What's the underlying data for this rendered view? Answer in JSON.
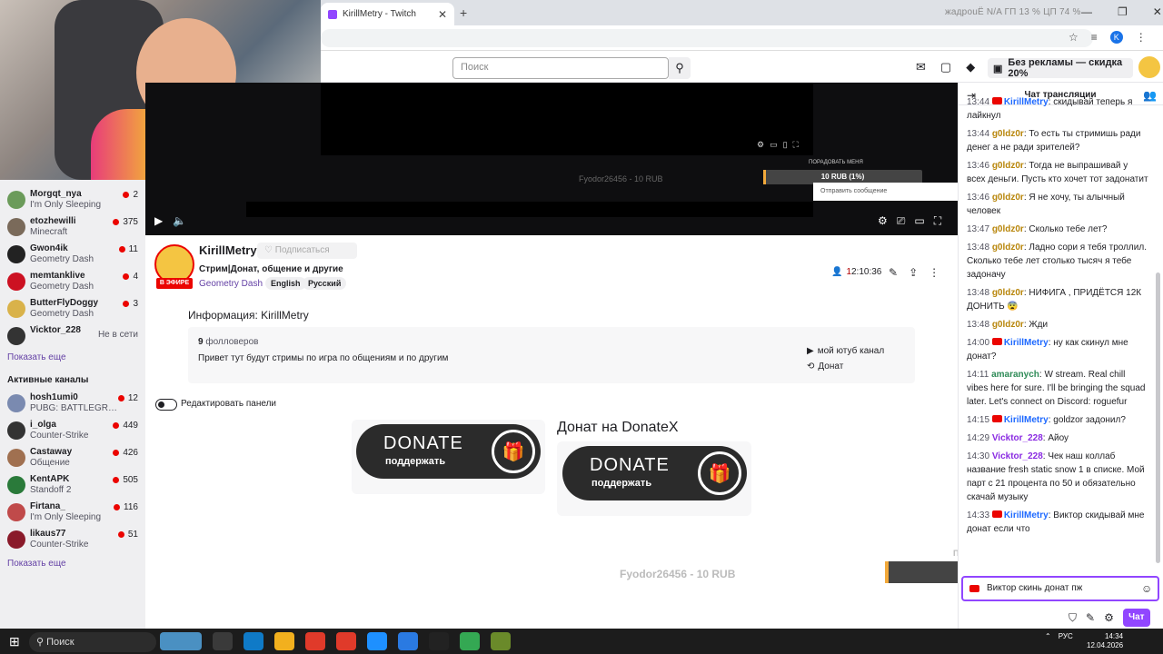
{
  "browser": {
    "tab_title": "KirillMetry - Twitch",
    "sys_monitor": "жадрouЁ N/A   ГП 13 %   ЦП 74 %",
    "profile_letter": "K"
  },
  "nav": {
    "search_placeholder": "Поиск",
    "promo": "Без рекламы — скидка 20%"
  },
  "sidebar": {
    "followed": [
      {
        "name": "Morgqt_nya",
        "game": "I'm Only Sleeping",
        "viewers": "2",
        "color": "#6b9b5a"
      },
      {
        "name": "etozhewilli",
        "game": "Minecraft",
        "viewers": "375",
        "color": "#7a6a5a"
      },
      {
        "name": "Gwon4ik",
        "game": "Geometry Dash",
        "viewers": "11",
        "color": "#222"
      },
      {
        "name": "memtanklive",
        "game": "Geometry Dash",
        "viewers": "4",
        "color": "#c12"
      },
      {
        "name": "ButterFlyDoggy",
        "game": "Geometry Dash",
        "viewers": "3",
        "color": "#d9b24a"
      },
      {
        "name": "Vicktor_228",
        "game": "",
        "offline": "Не в сети",
        "color": "#333"
      }
    ],
    "show_more": "Показать еще",
    "active_header": "Активные каналы",
    "active": [
      {
        "name": "hosh1umi0",
        "game": "PUBG: BATTLEGR…",
        "viewers": "12",
        "color": "#7a8ab0"
      },
      {
        "name": "i_olga",
        "game": "Counter-Strike",
        "viewers": "449",
        "color": "#333"
      },
      {
        "name": "Castaway",
        "game": "Общение",
        "viewers": "426",
        "color": "#a07050"
      },
      {
        "name": "KentAPK",
        "game": "Standoff 2",
        "viewers": "505",
        "color": "#2a7a3a"
      },
      {
        "name": "Firtana_",
        "game": "I'm Only Sleeping",
        "viewers": "116",
        "color": "#c04a4a"
      },
      {
        "name": "likaus77",
        "game": "Counter-Strike",
        "viewers": "51",
        "color": "#8a1a2a"
      }
    ],
    "show_more2": "Показать еще"
  },
  "player": {
    "alert_label": "ПОРАДОВАТЬ МЕНЯ",
    "alert_amount": "10 RUB (1%)",
    "donor": "Fyodor26456 - 10 RUB",
    "mini_chat_placeholder": "Отправить сообщение"
  },
  "channel": {
    "name": "KirillMetry",
    "follow": "Подписаться",
    "live": "В ЭФИРЕ",
    "title": "Стрим|Донат, общение и другие",
    "game": "Geometry Dash",
    "tags": [
      "English",
      "Русский"
    ],
    "viewers": "1",
    "uptime": "2:10:36"
  },
  "about": {
    "header": "Информация: KirillMetry",
    "followers_count": "9",
    "followers_label": " фолловеров",
    "bio": "Привет тут будут стримы по игра по общениям и по другим",
    "links": [
      "мой ютуб канал",
      "Донат"
    ],
    "edit_panels": "Редактировать панели"
  },
  "donate": {
    "btn_text": "DONATE",
    "btn_sub": "поддержать",
    "header": "Донат на DonateX"
  },
  "chat": {
    "header": "Чат трансляции",
    "messages": [
      {
        "ts": "13:44",
        "user": "KirillMetry",
        "color": "#1e69ff",
        "yt": true,
        "text": ": скидывай теперь я лайкнул"
      },
      {
        "ts": "13:44",
        "user": "g0ldz0r",
        "color": "#b8860b",
        "text": ": То есть ты стримишь ради денег а не ради зрителей?"
      },
      {
        "ts": "13:46",
        "user": "g0ldz0r",
        "color": "#b8860b",
        "text": ": Тогда не выпрашивай у всех деньги. Пусть кто хочет тот задонатит"
      },
      {
        "ts": "13:46",
        "user": "g0ldz0r",
        "color": "#b8860b",
        "text": ": Я не хочу, ты алычный человек"
      },
      {
        "ts": "13:47",
        "user": "g0ldz0r",
        "color": "#b8860b",
        "text": ": Сколько тебе лет?"
      },
      {
        "ts": "13:48",
        "user": "g0ldz0r",
        "color": "#b8860b",
        "text": ": Ладно сори я тебя троллил. Сколько тебе лет столько тысяч я тебе задоначу"
      },
      {
        "ts": "13:48",
        "user": "g0ldz0r",
        "color": "#b8860b",
        "text": ": НИФИГА , ПРИДЁТСЯ 12К ДОНИТЬ 😨"
      },
      {
        "ts": "13:48",
        "user": "g0ldz0r",
        "color": "#b8860b",
        "text": ": Жди"
      },
      {
        "ts": "14:00",
        "user": "KirillMetry",
        "color": "#1e69ff",
        "yt": true,
        "text": ": ну как скинул мне донат?"
      },
      {
        "ts": "14:11",
        "user": "amaranych",
        "color": "#2e8b57",
        "text": ": W stream. Real chill vibes here for sure. I'll be bringing the squad later. Let's connect on Discord: roguefur"
      },
      {
        "ts": "14:15",
        "user": "KirillMetry",
        "color": "#1e69ff",
        "yt": true,
        "text": ": goldzor задонил?"
      },
      {
        "ts": "14:29",
        "user": "Vicktor_228",
        "color": "#8a2be2",
        "text": ": Айоу"
      },
      {
        "ts": "14:30",
        "user": "Vicktor_228",
        "color": "#8a2be2",
        "text": ": Чек наш коллаб название fresh static snow 1 в списке. Мой парт с 21 процента по 50 и обязательно скачай музыку"
      },
      {
        "ts": "14:33",
        "user": "KirillMetry",
        "color": "#1e69ff",
        "yt": true,
        "text": ": Виктор скидывай мне донат если что"
      }
    ],
    "input_value": "Виктор скинь донат пж",
    "send": "Чат"
  },
  "taskbar": {
    "search": "Поиск",
    "lang": "РУС",
    "time": "14:34",
    "date": "12.04.2026"
  }
}
